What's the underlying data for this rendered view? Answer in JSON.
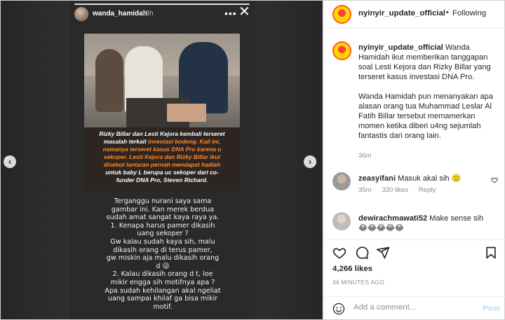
{
  "story": {
    "username": "wanda_hamidah",
    "time": "13h",
    "more": "•••",
    "close": "✕",
    "caption_lines": [
      {
        "text": "Rizky Billar dan Lesti Kejora kembali terseret",
        "hl": ""
      },
      {
        "text": "masalah terkait ",
        "hl": "investasi bodong. Kali ini,"
      },
      {
        "text": "",
        "hl": "namanya terseret kasus DNA Pro karena u"
      },
      {
        "text": "",
        "hl": "sekoper. Lesti Kejora dan Rizky Billar ikut"
      },
      {
        "text": "",
        "hl": "disebut lantaran pernah mendapat hadiah"
      },
      {
        "text": "untuk baby L berupa uc   sekoper dari co-",
        "hl": ""
      },
      {
        "text": "funder DNA Pro, Steven Richard.",
        "hl": ""
      }
    ],
    "text_lines": [
      "Terganggu nurani saya sama",
      "gambar ini. Kan merek berdua",
      "sudah amat sangat kaya raya ya.",
      "1. Kenapa harus pamer dikasih",
      "uang sekoper ?",
      "Gw kalau sudah kaya sih, malu",
      "dikasih orang di  terus pamer,",
      "gw miskin aja malu dikasih orang",
      "d    😜",
      "2.  Kalau dikasih orang d  t, loe",
      "mikir engga sih motifnya apa ?",
      "Apa sudah kehilangan akal ngeliat",
      "uang sampai khilaf ga bisa mikir",
      "motif."
    ],
    "nav_left": "‹",
    "nav_right": "›"
  },
  "header": {
    "username": "nyinyir_update_official",
    "separator": "•",
    "follow_label": "Following"
  },
  "post": {
    "username": "nyinyir_update_official",
    "paragraph1": " Wanda Hamidah ikut memberikan tanggapan soal Lesti Kejora dan Rizky Billar yang terseret kasus investasi DNA Pro.",
    "paragraph2": "Wanda Hamidah pun menanyakan apa alasan orang tua Muhammad Leslar Al Fatih Billar tersebut memamerkan momen ketika diberi u4ng sejumlah fantastis dari orang lain.",
    "time": "36m"
  },
  "comments": [
    {
      "username": "zeasyifani",
      "text": " Masuk akal sih 🙂",
      "time": "35m",
      "likes": "330 likes",
      "reply": "Reply"
    },
    {
      "username": "dewirachmawati52",
      "text": " Make sense sih 😂😂😂😂😂"
    }
  ],
  "likes": "4,266 likes",
  "posted_ago": "36 MINUTES AGO",
  "add_comment": {
    "placeholder": "Add a comment...",
    "post_label": "Post"
  },
  "colors": {
    "story_highlight": "#ff8a2b",
    "link_blue": "#b2dffc",
    "avatar_ring": "#ff5a1f"
  },
  "icons": [
    "heart-icon",
    "comment-icon",
    "share-icon",
    "bookmark-icon",
    "emoji-icon",
    "close-icon",
    "more-icon"
  ]
}
